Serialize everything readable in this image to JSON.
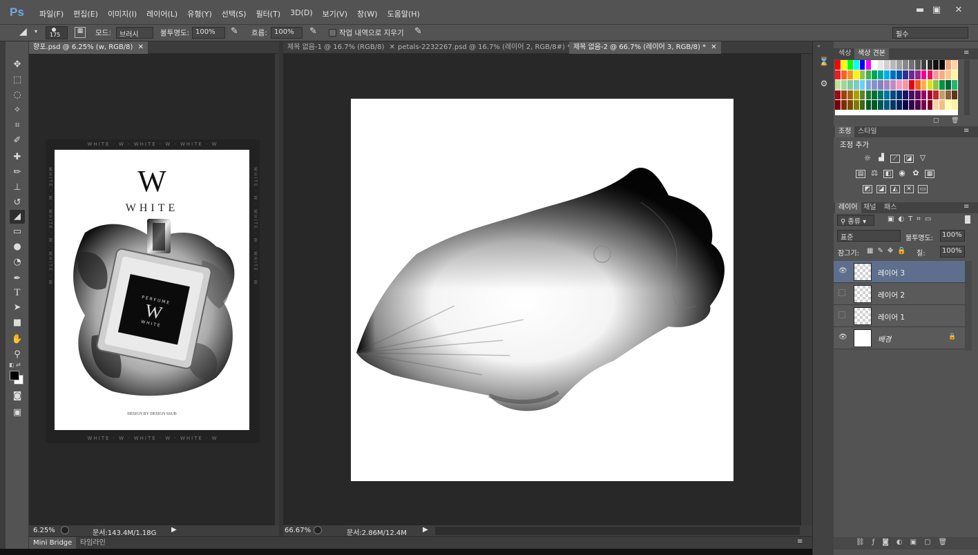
{
  "app": {
    "logo": "Ps",
    "brand_color": "#74a7e3"
  },
  "menu": [
    "파일(F)",
    "편집(E)",
    "이미지(I)",
    "레이어(L)",
    "유형(Y)",
    "선택(S)",
    "필터(T)",
    "3D(D)",
    "보기(V)",
    "창(W)",
    "도움말(H)"
  ],
  "window_controls": {
    "minimize": "▬",
    "maximize": "▣",
    "close": "✕"
  },
  "options": {
    "brush_size": "175",
    "mode_label": "모드:",
    "mode_value": "브러시",
    "opacity_label": "불투명도:",
    "opacity_value": "100%",
    "flow_label": "흐름:",
    "flow_value": "100%",
    "erase_history_label": "작업 내역으로 지우기",
    "workspace": "필수"
  },
  "doc1": {
    "tab": "향포.psd @ 6.25% (w, RGB/8)",
    "zoom": "6.25%",
    "doc_size": "문서:143.4M/1.18G",
    "poster": {
      "logo_letter": "W",
      "brand": "WHITE",
      "label_top": "PERFUME",
      "label_letter": "W",
      "label_bottom": "WHITE",
      "footer": "DESIGN BY DESIGN SSUB",
      "border_text": "WHITE · W · WHITE · W · WHITE · W"
    }
  },
  "doc2": {
    "tabs": [
      "제목 없음-1 @ 16.7% (RGB/8)",
      "petals-2232267.psd @ 16.7% (레이어 2, RGB/8#) *",
      "제목 없음-2 @ 66.7% (레이어 3, RGB/8) *"
    ],
    "zoom": "66.67%",
    "doc_size": "문서:2.86M/12.4M"
  },
  "bottom_tabs": [
    "Mini Bridge",
    "타임라인"
  ],
  "swatches_panel": {
    "tabs": [
      "색상",
      "색상 견본"
    ]
  },
  "adjustments_panel": {
    "tabs": [
      "조정",
      "스타일"
    ],
    "title": "조정 추가"
  },
  "layers_panel": {
    "tabs": [
      "레이어",
      "채널",
      "패스"
    ],
    "filter_kind": "종류",
    "blend_mode": "표준",
    "opacity_label": "불투명도:",
    "opacity_value": "100%",
    "lock_label": "잠그기:",
    "fill_label": "칠:",
    "fill_value": "100%",
    "layers": [
      {
        "name": "레이어 3",
        "visible": true,
        "selected": true
      },
      {
        "name": "레이어 2",
        "visible": false,
        "selected": false
      },
      {
        "name": "레이어 1",
        "visible": false,
        "selected": false
      },
      {
        "name": "배경",
        "visible": true,
        "selected": false,
        "locked": true
      }
    ]
  }
}
